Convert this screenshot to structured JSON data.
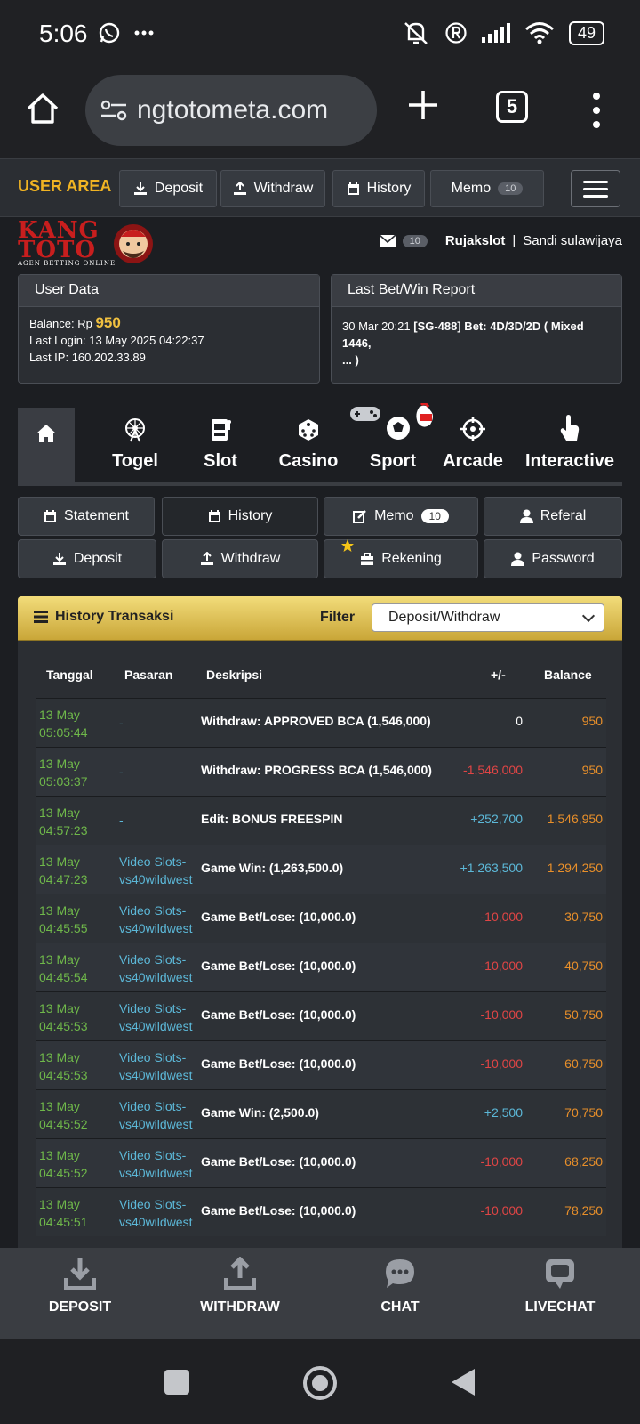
{
  "status": {
    "time": "5:06",
    "battery": "49"
  },
  "browser": {
    "url": "ngtotometa.com",
    "tab_count": "5"
  },
  "nav": {
    "user_area": "USER AREA",
    "deposit": "Deposit",
    "withdraw": "Withdraw",
    "history": "History",
    "memo": "Memo",
    "memo_count": "10"
  },
  "logo": {
    "line1": "KANG",
    "line2": "TOTO",
    "tagline": "AGEN BETTING ONLINE"
  },
  "user": {
    "mail_count": "10",
    "username": "Rujakslot",
    "separator": "|",
    "name": "Sandi sulawijaya"
  },
  "user_data": {
    "title": "User Data",
    "balance_label": "Balance: Rp",
    "balance_value": "950",
    "last_login": "Last Login: 13 May 2025 04:22:37",
    "last_ip": "Last IP: 160.202.33.89"
  },
  "last_bet": {
    "title": "Last Bet/Win Report",
    "time": "30 Mar 20:21",
    "detail": "[SG-488] Bet: 4D/3D/2D ( Mixed 1446,",
    "detail_more": "... )"
  },
  "categories": [
    "Togel",
    "Slot",
    "Casino",
    "Sport",
    "Arcade",
    "Interactive"
  ],
  "sub_menu": {
    "statement": "Statement",
    "history": "History",
    "memo": "Memo",
    "memo_count": "10",
    "referal": "Referal",
    "deposit": "Deposit",
    "withdraw": "Withdraw",
    "rekening": "Rekening",
    "password": "Password"
  },
  "history": {
    "title": "History Transaksi",
    "filter_label": "Filter",
    "filter_value": "Deposit/Withdraw",
    "columns": [
      "Tanggal",
      "Pasaran",
      "Deskripsi",
      "+/-",
      "Balance"
    ],
    "rows": [
      {
        "date": "13 May",
        "time": "05:05:44",
        "pasaran1": "-",
        "pasaran2": "",
        "desc": "Withdraw: APPROVED BCA (1,546,000)",
        "amount": "0",
        "type": "zero",
        "balance": "950"
      },
      {
        "date": "13 May",
        "time": "05:03:37",
        "pasaran1": "-",
        "pasaran2": "",
        "desc": "Withdraw: PROGRESS BCA (1,546,000)",
        "amount": "-1,546,000",
        "type": "neg",
        "balance": "950"
      },
      {
        "date": "13 May",
        "time": "04:57:23",
        "pasaran1": "-",
        "pasaran2": "",
        "desc": "Edit: BONUS FREESPIN",
        "amount": "+252,700",
        "type": "pos",
        "balance": "1,546,950"
      },
      {
        "date": "13 May",
        "time": "04:47:23",
        "pasaran1": "Video Slots-",
        "pasaran2": "vs40wildwest",
        "desc": "Game Win: (1,263,500.0)",
        "amount": "+1,263,500",
        "type": "pos",
        "balance": "1,294,250"
      },
      {
        "date": "13 May",
        "time": "04:45:55",
        "pasaran1": "Video Slots-",
        "pasaran2": "vs40wildwest",
        "desc": "Game Bet/Lose: (10,000.0)",
        "amount": "-10,000",
        "type": "neg",
        "balance": "30,750"
      },
      {
        "date": "13 May",
        "time": "04:45:54",
        "pasaran1": "Video Slots-",
        "pasaran2": "vs40wildwest",
        "desc": "Game Bet/Lose: (10,000.0)",
        "amount": "-10,000",
        "type": "neg",
        "balance": "40,750"
      },
      {
        "date": "13 May",
        "time": "04:45:53",
        "pasaran1": "Video Slots-",
        "pasaran2": "vs40wildwest",
        "desc": "Game Bet/Lose: (10,000.0)",
        "amount": "-10,000",
        "type": "neg",
        "balance": "50,750"
      },
      {
        "date": "13 May",
        "time": "04:45:53",
        "pasaran1": "Video Slots-",
        "pasaran2": "vs40wildwest",
        "desc": "Game Bet/Lose: (10,000.0)",
        "amount": "-10,000",
        "type": "neg",
        "balance": "60,750"
      },
      {
        "date": "13 May",
        "time": "04:45:52",
        "pasaran1": "Video Slots-",
        "pasaran2": "vs40wildwest",
        "desc": "Game Win: (2,500.0)",
        "amount": "+2,500",
        "type": "pos",
        "balance": "70,750"
      },
      {
        "date": "13 May",
        "time": "04:45:52",
        "pasaran1": "Video Slots-",
        "pasaran2": "vs40wildwest",
        "desc": "Game Bet/Lose: (10,000.0)",
        "amount": "-10,000",
        "type": "neg",
        "balance": "68,250"
      },
      {
        "date": "13 May",
        "time": "04:45:51",
        "pasaran1": "Video Slots-",
        "pasaran2": "vs40wildwest",
        "desc": "Game Bet/Lose: (10,000.0)",
        "amount": "-10,000",
        "type": "neg",
        "balance": "78,250"
      }
    ]
  },
  "bottom_bar": {
    "deposit": "DEPOSIT",
    "withdraw": "WITHDRAW",
    "chat": "CHAT",
    "livechat": "LIVECHAT"
  },
  "colors": {
    "accent": "#f0b323",
    "positive": "#5cb8d8",
    "negative": "#e04545",
    "balance": "#e88f2a",
    "date": "#6fb84a"
  }
}
